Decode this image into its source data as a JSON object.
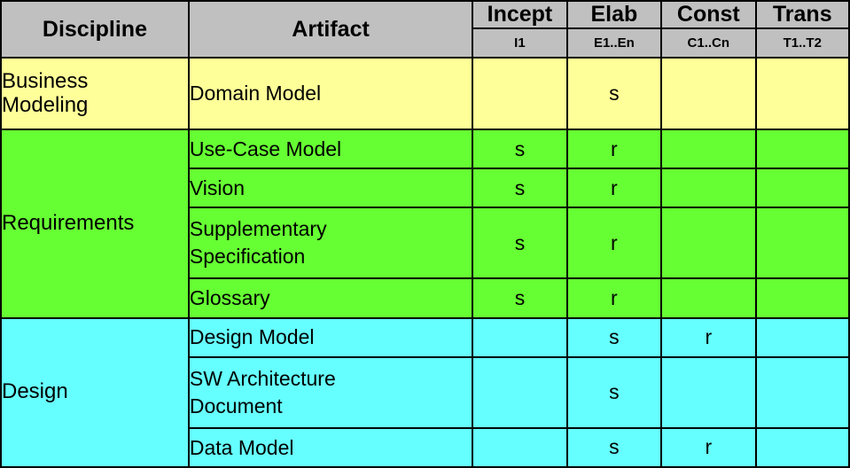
{
  "table": {
    "header": {
      "discipline_label": "Discipline",
      "artifact_label": "Artifact",
      "phases": [
        {
          "name": "Incept",
          "iterations": "I1"
        },
        {
          "name": "Elab",
          "iterations": "E1..En"
        },
        {
          "name": "Const",
          "iterations": "C1..Cn"
        },
        {
          "name": "Trans",
          "iterations": "T1..T2"
        }
      ]
    },
    "colors": {
      "header_background": "#c0c0c0",
      "business_modeling_band": "#ffff99",
      "requirements_band": "#66ff33",
      "design_band": "#66ffff",
      "border": "#000000",
      "text": "#000000"
    },
    "disciplines": [
      {
        "name": "Business Modeling",
        "name_line1": "Business",
        "name_line2": "Modeling",
        "band_color": "#ffff99",
        "rows": [
          {
            "artifact": "Domain Model",
            "artifact_line1": "Domain Model",
            "artifact_line2": "",
            "marks": {
              "Incept": "",
              "Elab": "s",
              "Const": "",
              "Trans": ""
            }
          }
        ]
      },
      {
        "name": "Requirements",
        "name_line1": "Requirements",
        "name_line2": "",
        "band_color": "#66ff33",
        "rows": [
          {
            "artifact": "Use-Case Model",
            "artifact_line1": "Use-Case Model",
            "artifact_line2": "",
            "marks": {
              "Incept": "s",
              "Elab": "r",
              "Const": "",
              "Trans": ""
            }
          },
          {
            "artifact": "Vision",
            "artifact_line1": "Vision",
            "artifact_line2": "",
            "marks": {
              "Incept": "s",
              "Elab": "r",
              "Const": "",
              "Trans": ""
            }
          },
          {
            "artifact": "Supplementary Specification",
            "artifact_line1": "Supplementary",
            "artifact_line2": "Specification",
            "marks": {
              "Incept": "s",
              "Elab": "r",
              "Const": "",
              "Trans": ""
            }
          },
          {
            "artifact": "Glossary",
            "artifact_line1": "Glossary",
            "artifact_line2": "",
            "marks": {
              "Incept": "s",
              "Elab": "r",
              "Const": "",
              "Trans": ""
            }
          }
        ]
      },
      {
        "name": "Design",
        "name_line1": "Design",
        "name_line2": "",
        "band_color": "#66ffff",
        "rows": [
          {
            "artifact": "Design Model",
            "artifact_line1": "Design Model",
            "artifact_line2": "",
            "marks": {
              "Incept": "",
              "Elab": "s",
              "Const": "r",
              "Trans": ""
            }
          },
          {
            "artifact": "SW Architecture Document",
            "artifact_line1": "SW Architecture",
            "artifact_line2": "Document",
            "marks": {
              "Incept": "",
              "Elab": "s",
              "Const": "",
              "Trans": ""
            }
          },
          {
            "artifact": "Data Model",
            "artifact_line1": "Data Model",
            "artifact_line2": "",
            "marks": {
              "Incept": "",
              "Elab": "s",
              "Const": "r",
              "Trans": ""
            }
          }
        ]
      }
    ]
  }
}
